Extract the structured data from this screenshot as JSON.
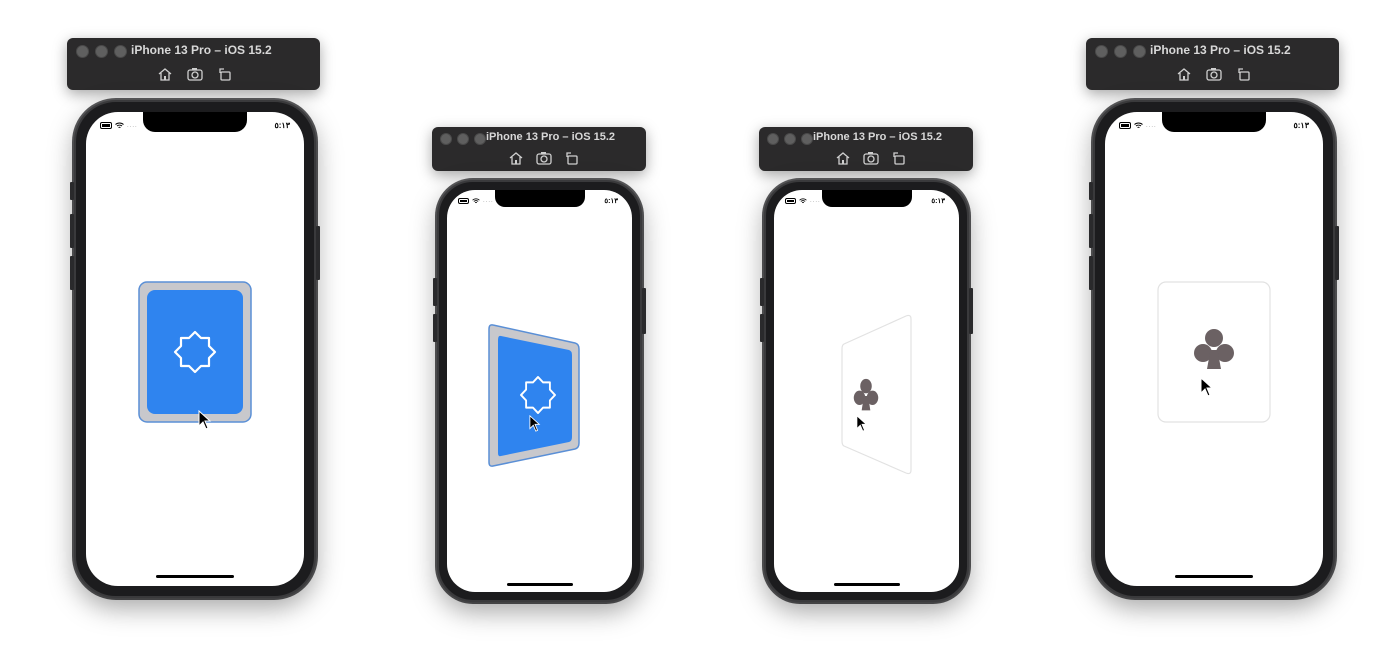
{
  "simulators": [
    {
      "window_title": "iPhone 13 Pro – iOS 15.2",
      "status_time": "٥:١٣",
      "card_state": "back",
      "card_colors": {
        "frame": "#c8c8cc",
        "face": "#2f84ef",
        "outline": "#5a8fd6",
        "emblem": "#ffffff"
      }
    },
    {
      "window_title": "iPhone 13 Pro – iOS 15.2",
      "status_time": "٥:١٣",
      "card_state": "back-rotating",
      "card_colors": {
        "frame": "#c8c8cc",
        "face": "#2f84ef",
        "outline": "#5a8fd6",
        "emblem": "#ffffff"
      }
    },
    {
      "window_title": "iPhone 13 Pro – iOS 15.2",
      "status_time": "٥:١٣",
      "card_state": "front-rotating",
      "card_colors": {
        "frame": "#e6e6e6",
        "face": "#ffffff",
        "suit": "#6b6163"
      }
    },
    {
      "window_title": "iPhone 13 Pro – iOS 15.2",
      "status_time": "٥:١٣",
      "card_state": "front",
      "card_colors": {
        "frame": "#e6e6e6",
        "face": "#ffffff",
        "suit": "#6b6163"
      }
    }
  ],
  "toolbar_icons": [
    "home-icon",
    "screenshot-icon",
    "rotate-icon"
  ],
  "suit": "clubs"
}
